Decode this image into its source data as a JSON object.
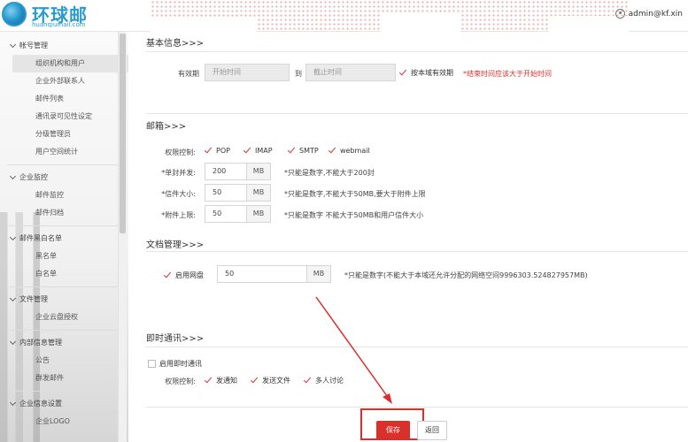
{
  "header": {
    "logo_title": "环球邮",
    "logo_sub": "huanqiumail.com",
    "user": "admin@kf.xin"
  },
  "sidebar": {
    "groups": [
      {
        "label": "帐号管理",
        "items": [
          "组织机构和用户",
          "企业外部联系人",
          "邮件列表",
          "通讯录可见性设定",
          "分级管理员",
          "用户空间统计"
        ]
      },
      {
        "label": "企业监控",
        "items": [
          "邮件监控",
          "邮件归档"
        ]
      },
      {
        "label": "邮件黑白名单",
        "items": [
          "黑名单",
          "白名单"
        ]
      },
      {
        "label": "文件管理",
        "items": [
          "企业云盘授权"
        ]
      },
      {
        "label": "内部信息管理",
        "items": [
          "公告",
          "群发邮件"
        ]
      },
      {
        "label": "企业信息设置",
        "items": [
          "企业LOGO"
        ]
      }
    ]
  },
  "basic": {
    "title": "基本信息>>>",
    "validity_label": "有效期",
    "start_placeholder": "开始时间",
    "to": "到",
    "end_placeholder": "截止时间",
    "domain_validity": "按本域有效期",
    "note": "*结束时间应该大于开始时间"
  },
  "mailbox": {
    "title": "邮箱>>>",
    "perm_label": "权限控制:",
    "perms": [
      "POP",
      "IMAP",
      "SMTP",
      "webmail"
    ],
    "concurrent_label": "*单封并发:",
    "concurrent_value": "200",
    "concurrent_unit": "MB",
    "concurrent_note": "*只能是数字,不能大于200封",
    "size_label": "*信件大小:",
    "size_value": "50",
    "size_unit": "MB",
    "size_note": "*只能是数字,不能大于50MB,要大于附件上限",
    "attach_label": "*附件上限:",
    "attach_value": "50",
    "attach_unit": "MB",
    "attach_note": "*只能是数字 不能大于50MB和用户信件大小"
  },
  "docs": {
    "title": "文档管理>>>",
    "enable_disk": "启用网盘",
    "disk_value": "50",
    "disk_unit": "MB",
    "disk_note": "*只能是数字(不能大于本域还允许分配的网络空间9996303.524827957MB)"
  },
  "im": {
    "title": "即时通讯>>>",
    "enable_im": "启用即时通讯",
    "perm_label": "权限控制:",
    "perms": [
      "发通知",
      "发送文件",
      "多人讨论"
    ]
  },
  "actions": {
    "save": "保存",
    "back": "返回"
  },
  "colors": {
    "accent": "#d9302c",
    "logo": "#2a9bd1"
  }
}
